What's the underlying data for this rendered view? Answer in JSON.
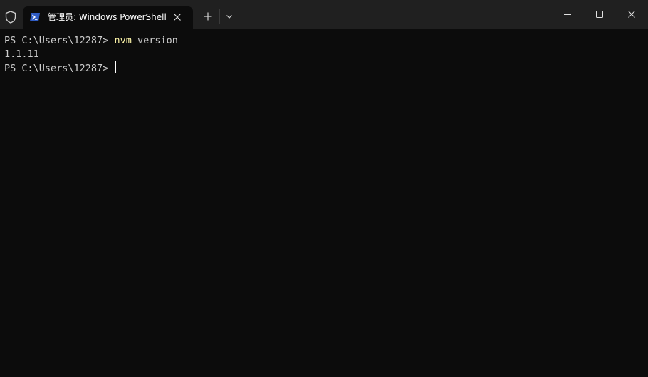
{
  "window": {
    "tab_title": "管理员: Windows PowerShell"
  },
  "icons": {
    "shield": "shield-icon",
    "tab": "powershell-icon",
    "tab_close": "close-icon",
    "new_tab": "plus-icon",
    "dropdown": "chevron-down-icon",
    "minimize": "minimize-icon",
    "maximize": "maximize-icon",
    "close": "close-icon"
  },
  "terminal": {
    "line1_prompt": "PS C:\\Users\\12287> ",
    "line1_cmd": "nvm",
    "line1_args": " version",
    "line2_output": "1.1.11",
    "line3_prompt": "PS C:\\Users\\12287> "
  },
  "colors": {
    "background": "#0c0c0c",
    "titlebar": "#202020",
    "text": "#cccccc",
    "command": "#f9f1a5",
    "powershell_blue": "#2f5cc4"
  }
}
